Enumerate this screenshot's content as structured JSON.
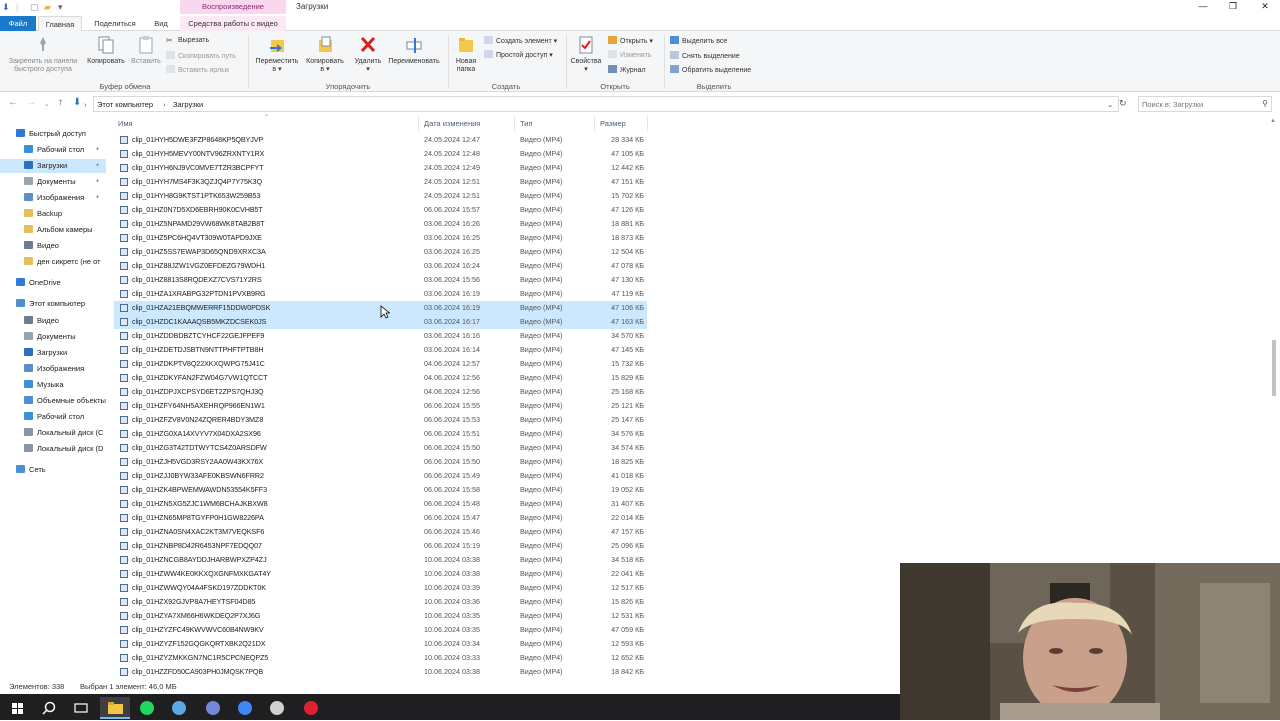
{
  "titlebar": {
    "context_tab": "Воспроизведение",
    "window_title": "Загрузки",
    "minimize": "—",
    "maximize": "❐",
    "close": "✕"
  },
  "tabs": [
    "Файл",
    "Главная",
    "Поделиться",
    "Вид",
    "Средства работы с видео"
  ],
  "ribbon": {
    "clipboard": {
      "pin": "Закрепить на панели быстрого доступа",
      "copy": "Копировать",
      "paste": "Вставить",
      "cut": "Вырезать",
      "copy_path": "Скопировать путь",
      "paste_shortcut": "Вставить ярлык",
      "group": "Буфер обмена"
    },
    "organize": {
      "move_to": "Переместить",
      "copy_to": "Копировать",
      "dest": "в ▾",
      "delete": "Удалить",
      "rename": "Переименовать",
      "group": "Упорядочить"
    },
    "create": {
      "new_folder": "Новая папка",
      "new_item": "Создать элемент ▾",
      "easy_access": "Простой доступ ▾",
      "group": "Создать"
    },
    "open": {
      "properties": "Свойства",
      "open": "Открыть ▾",
      "edit": "Изменить",
      "history": "Журнал",
      "group": "Открыть"
    },
    "select": {
      "select_all": "Выделить все",
      "select_none": "Снять выделение",
      "invert": "Обратить выделение",
      "group": "Выделить"
    }
  },
  "address": {
    "path": [
      "Этот компьютер",
      "Загрузки"
    ],
    "separator": "›",
    "search_placeholder": "Поиск в: Загрузки"
  },
  "nav": {
    "items": [
      {
        "label": "Быстрый доступ",
        "icon": "star-icon",
        "color": "#2f7ad6",
        "pinned": false,
        "indent": 0,
        "selected": false
      },
      {
        "label": "Рабочий стол",
        "icon": "desktop-icon",
        "color": "#3a8fd8",
        "pinned": true,
        "indent": 1,
        "selected": false
      },
      {
        "label": "Загрузки",
        "icon": "download-icon",
        "color": "#2c6fbf",
        "pinned": true,
        "indent": 1,
        "selected": true
      },
      {
        "label": "Документы",
        "icon": "documents-icon",
        "color": "#9aa4b0",
        "pinned": true,
        "indent": 1,
        "selected": false
      },
      {
        "label": "Изображения",
        "icon": "pictures-icon",
        "color": "#5e8fc4",
        "pinned": true,
        "indent": 1,
        "selected": false
      },
      {
        "label": "Backup",
        "icon": "folder-icon",
        "color": "#e8c05a",
        "pinned": false,
        "indent": 1,
        "selected": false
      },
      {
        "label": "Альбом камеры",
        "icon": "folder-icon",
        "color": "#e8c05a",
        "pinned": false,
        "indent": 1,
        "selected": false
      },
      {
        "label": "Видео",
        "icon": "video-icon",
        "color": "#6b7c93",
        "pinned": false,
        "indent": 1,
        "selected": false
      },
      {
        "label": "ден сикретс  (не от",
        "icon": "folder-icon",
        "color": "#e8c05a",
        "pinned": false,
        "indent": 1,
        "selected": false
      },
      {
        "label": "OneDrive",
        "icon": "cloud-icon",
        "color": "#2f7ad6",
        "pinned": false,
        "indent": 0,
        "selected": false
      },
      {
        "label": "Этот компьютер",
        "icon": "computer-icon",
        "color": "#4f8ed0",
        "pinned": false,
        "indent": 0,
        "selected": false
      },
      {
        "label": "Видео",
        "icon": "video-icon",
        "color": "#6b7c93",
        "pinned": false,
        "indent": 1,
        "selected": false
      },
      {
        "label": "Документы",
        "icon": "documents-icon",
        "color": "#9aa4b0",
        "pinned": false,
        "indent": 1,
        "selected": false
      },
      {
        "label": "Загрузки",
        "icon": "download-icon",
        "color": "#2c6fbf",
        "pinned": false,
        "indent": 1,
        "selected": false
      },
      {
        "label": "Изображения",
        "icon": "pictures-icon",
        "color": "#5e8fc4",
        "pinned": false,
        "indent": 1,
        "selected": false
      },
      {
        "label": "Музыка",
        "icon": "music-icon",
        "color": "#3a8fd8",
        "pinned": false,
        "indent": 1,
        "selected": false
      },
      {
        "label": "Объемные объекты",
        "icon": "3d-objects-icon",
        "color": "#4f8ed0",
        "pinned": false,
        "indent": 1,
        "selected": false
      },
      {
        "label": "Рабочий стол",
        "icon": "desktop-icon",
        "color": "#3a8fd8",
        "pinned": false,
        "indent": 1,
        "selected": false
      },
      {
        "label": "Локальный диск (C",
        "icon": "drive-icon",
        "color": "#8a96a6",
        "pinned": false,
        "indent": 1,
        "selected": false
      },
      {
        "label": "Локальный диск (D",
        "icon": "drive-icon",
        "color": "#8a96a6",
        "pinned": false,
        "indent": 1,
        "selected": false
      },
      {
        "label": "Сеть",
        "icon": "network-icon",
        "color": "#4f8ed0",
        "pinned": false,
        "indent": 0,
        "selected": false
      }
    ]
  },
  "columns": {
    "name": "Имя",
    "date": "Дата изменения",
    "type": "Тип",
    "size": "Размер"
  },
  "files": [
    {
      "name": "clip_01HYH5DWE3FZP8648KP5QBYJVP",
      "date": "24.05.2024 12:47",
      "type": "Видео (MP4)",
      "size": "28 334 КБ",
      "selected": false
    },
    {
      "name": "clip_01HYH5MEVY00NTV96ZRXNTY1RX",
      "date": "24.05.2024 12:48",
      "type": "Видео (MP4)",
      "size": "47 105 КБ",
      "selected": false
    },
    {
      "name": "clip_01HYH6NJ9VC0MVE7TZR3BCPFYT",
      "date": "24.05.2024 12:49",
      "type": "Видео (MP4)",
      "size": "12 442 КБ",
      "selected": false
    },
    {
      "name": "clip_01HYH7MS4F3K3QZJQ4P7Y75K3Q",
      "date": "24.05.2024 12:51",
      "type": "Видео (MP4)",
      "size": "47 151 КБ",
      "selected": false
    },
    {
      "name": "clip_01HYH8G9KTST1PTK653W259B53",
      "date": "24.05.2024 12:51",
      "type": "Видео (MP4)",
      "size": "15 702 КБ",
      "selected": false
    },
    {
      "name": "clip_01HZ0N7D5XD6EBRH90K0CVHB5T",
      "date": "06.06.2024 15:57",
      "type": "Видео (MP4)",
      "size": "47 126 КБ",
      "selected": false
    },
    {
      "name": "clip_01HZ5NPAMD29VW68WK8TAB2B8T",
      "date": "03.06.2024 16:26",
      "type": "Видео (MP4)",
      "size": "18 881 КБ",
      "selected": false
    },
    {
      "name": "clip_01HZ5PC6HQ4VT309W0TAPD9JXE",
      "date": "03.06.2024 16:25",
      "type": "Видео (MP4)",
      "size": "18 873 КБ",
      "selected": false
    },
    {
      "name": "clip_01HZ5SS7EWAP3D65QND9XRXC3A",
      "date": "03.06.2024 16:25",
      "type": "Видео (MP4)",
      "size": "12 504 КБ",
      "selected": false
    },
    {
      "name": "clip_01HZ88JZW1VGZ0EFDEZG79WDH1",
      "date": "03.06.2024 16:24",
      "type": "Видео (MP4)",
      "size": "47 078 КБ",
      "selected": false
    },
    {
      "name": "clip_01HZ8813S8RQDEXZ7CVS71Y2RS",
      "date": "03.06.2024 15:56",
      "type": "Видео (MP4)",
      "size": "47 130 КБ",
      "selected": false
    },
    {
      "name": "clip_01HZA1XRABPG32PTDN1PVXB9RG",
      "date": "03.06.2024 16:19",
      "type": "Видео (MP4)",
      "size": "47 119 КБ",
      "selected": false
    },
    {
      "name": "clip_01HZA21EBQMWERRF15DDW0PDSK",
      "date": "03.06.2024 16:19",
      "type": "Видео (MP4)",
      "size": "47 106 КБ",
      "selected": true
    },
    {
      "name": "clip_01HZDC1KAAAQSB5MKZDCSEK0JS",
      "date": "03.06.2024 16:17",
      "type": "Видео (MP4)",
      "size": "47 163 КБ",
      "selected": true
    },
    {
      "name": "clip_01HZDDBDBZTCYHCF22GEJFPEF9",
      "date": "03.06.2024 16:16",
      "type": "Видео (MP4)",
      "size": "34 570 КБ",
      "selected": false
    },
    {
      "name": "clip_01HZDETDJSBTN9NTTPHFTPTB8H",
      "date": "03.06.2024 16:14",
      "type": "Видео (MP4)",
      "size": "47 145 КБ",
      "selected": false
    },
    {
      "name": "clip_01HZDKPTV8Q22XKXQWPG75J41C",
      "date": "04.06.2024 12:57",
      "type": "Видео (MP4)",
      "size": "15 732 КБ",
      "selected": false
    },
    {
      "name": "clip_01HZDKYFAN2FZW04G7VW1QTCCT",
      "date": "04.06.2024 12:56",
      "type": "Видео (MP4)",
      "size": "15 829 КБ",
      "selected": false
    },
    {
      "name": "clip_01HZDPJXCPSYD6ET2ZPS7QHJ3Q",
      "date": "04.06.2024 12:56",
      "type": "Видео (MP4)",
      "size": "25 168 КБ",
      "selected": false
    },
    {
      "name": "clip_01HZFY64NH5AXEHRQP966EN1W1",
      "date": "06.06.2024 15:55",
      "type": "Видео (MP4)",
      "size": "25 121 КБ",
      "selected": false
    },
    {
      "name": "clip_01HZFZV8V0N24ZQRER4BDY3MZ8",
      "date": "06.06.2024 15:53",
      "type": "Видео (MP4)",
      "size": "25 147 КБ",
      "selected": false
    },
    {
      "name": "clip_01HZG0XA14XVYV7X04DXA2SX96",
      "date": "06.06.2024 15:51",
      "type": "Видео (MP4)",
      "size": "34 576 КБ",
      "selected": false
    },
    {
      "name": "clip_01HZG3T42TDTWYTCS4Z0ARSDFW",
      "date": "06.06.2024 15:50",
      "type": "Видео (MP4)",
      "size": "34 574 КБ",
      "selected": false
    },
    {
      "name": "clip_01HZJH5VGD3RSY2AA0W43KX76X",
      "date": "06.06.2024 15:50",
      "type": "Видео (MP4)",
      "size": "18 825 КБ",
      "selected": false
    },
    {
      "name": "clip_01HZJJ0BYW33AFE0KBSWN6FRR2",
      "date": "06.06.2024 15:49",
      "type": "Видео (MP4)",
      "size": "41 018 КБ",
      "selected": false
    },
    {
      "name": "clip_01HZK4BPWEMWAWDN53554K5FF3",
      "date": "06.06.2024 15:58",
      "type": "Видео (MP4)",
      "size": "19 052 КБ",
      "selected": false
    },
    {
      "name": "clip_01HZN5XG5ZJC1WM6BCHAJKBXW8",
      "date": "06.06.2024 15:48",
      "type": "Видео (MP4)",
      "size": "31 407 КБ",
      "selected": false
    },
    {
      "name": "clip_01HZN65MP8TGYFP0H1GW8226PA",
      "date": "06.06.2024 15:47",
      "type": "Видео (MP4)",
      "size": "22 014 КБ",
      "selected": false
    },
    {
      "name": "clip_01HZNA0SN4XAC2KT3M7VEQKSF6",
      "date": "06.06.2024 15:46",
      "type": "Видео (MP4)",
      "size": "47 157 КБ",
      "selected": false
    },
    {
      "name": "clip_01HZNBP8D42R6453NPF7EDQQ07",
      "date": "06.06.2024 15:19",
      "type": "Видео (MP4)",
      "size": "25 096 КБ",
      "selected": false
    },
    {
      "name": "clip_01HZNCGB8AYDDJHARBWPXZP4ZJ",
      "date": "10.06.2024 03:38",
      "type": "Видео (MP4)",
      "size": "34 518 КБ",
      "selected": false
    },
    {
      "name": "clip_01HZWW4KE0KKXQXGNFMXKGAT4Y",
      "date": "10.06.2024 03:38",
      "type": "Видео (MP4)",
      "size": "22 041 КБ",
      "selected": false
    },
    {
      "name": "clip_01HZWWQY04A4FSKD197ZDDKT0K",
      "date": "10.06.2024 03:39",
      "type": "Видео (MP4)",
      "size": "12 517 КБ",
      "selected": false
    },
    {
      "name": "clip_01HZX92GJVP8A7HEYTSF04D85",
      "date": "10.06.2024 03:36",
      "type": "Видео (MP4)",
      "size": "15 826 КБ",
      "selected": false
    },
    {
      "name": "clip_01HZYA7XM66H6WKDEQ2P7XJ6G",
      "date": "10.06.2024 03:35",
      "type": "Видео (MP4)",
      "size": "12 531 КБ",
      "selected": false
    },
    {
      "name": "clip_01HZYZFC49KWVWVC60B4NW9KV",
      "date": "10.06.2024 03:35",
      "type": "Видео (MP4)",
      "size": "47 059 КБ",
      "selected": false
    },
    {
      "name": "clip_01HZYZF152GQGKQRTXBK2Q21DX",
      "date": "10.06.2024 03:34",
      "type": "Видео (MP4)",
      "size": "12 593 КБ",
      "selected": false
    },
    {
      "name": "clip_01HZYZMKKGN7NC1R5CPCNEQPZ5",
      "date": "10.06.2024 03:33",
      "type": "Видео (MP4)",
      "size": "12 652 КБ",
      "selected": false
    },
    {
      "name": "clip_01HZZFD50CA903PH0JMQSK7PQB",
      "date": "10.06.2024 03:38",
      "type": "Видео (MP4)",
      "size": "18 842 КБ",
      "selected": false
    }
  ],
  "status": {
    "count": "Элементов: 338",
    "selection": "Выбран 1 элемент: 46,0 МБ"
  },
  "taskbar": {
    "items": [
      {
        "name": "start-icon",
        "color": "#ffffff"
      },
      {
        "name": "search-icon",
        "color": "#ffffff"
      },
      {
        "name": "task-view-icon",
        "color": "#ffffff"
      },
      {
        "name": "file-explorer-icon",
        "color": "#f1c646"
      },
      {
        "name": "spotify-icon",
        "color": "#1ed760"
      },
      {
        "name": "telegram-icon",
        "color": "#5aa9e6"
      },
      {
        "name": "discord-icon",
        "color": "#7289da"
      },
      {
        "name": "chrome-icon",
        "color": "#4285f4"
      },
      {
        "name": "obs-icon",
        "color": "#d0d0d0"
      },
      {
        "name": "opera-icon",
        "color": "#e0202f"
      }
    ]
  },
  "colors": {
    "accent": "#1979ca",
    "selection": "#cce8ff",
    "context_tab": "#f8d7ef"
  }
}
